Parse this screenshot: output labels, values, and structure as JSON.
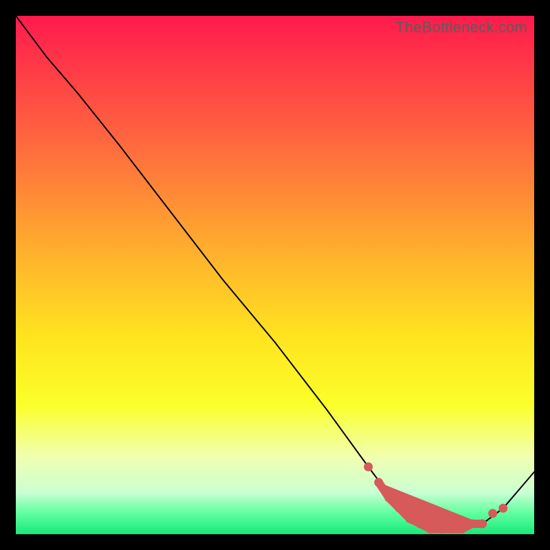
{
  "watermark": "TheBottleneck.com",
  "chart_data": {
    "type": "line",
    "title": "",
    "xlabel": "",
    "ylabel": "",
    "ylim": [
      0,
      100
    ],
    "xlim": [
      0,
      100
    ],
    "background_gradient_stops": [
      {
        "pct": 0,
        "color": "#ff1a4d"
      },
      {
        "pct": 10,
        "color": "#ff3a47"
      },
      {
        "pct": 25,
        "color": "#ff6a3e"
      },
      {
        "pct": 45,
        "color": "#ffae2e"
      },
      {
        "pct": 62,
        "color": "#ffe41f"
      },
      {
        "pct": 75,
        "color": "#fbff2a"
      },
      {
        "pct": 85,
        "color": "#f1ffb0"
      },
      {
        "pct": 92,
        "color": "#c9ffd2"
      },
      {
        "pct": 96,
        "color": "#5effa0"
      },
      {
        "pct": 100,
        "color": "#19e87a"
      }
    ],
    "series": [
      {
        "name": "bottleneck-curve",
        "x": [
          0,
          6,
          12,
          20,
          30,
          40,
          50,
          60,
          68,
          74,
          78,
          82,
          86,
          90,
          94,
          100
        ],
        "y": [
          100,
          92,
          85,
          75,
          62,
          49,
          37,
          24,
          13,
          5,
          2,
          1,
          1,
          2,
          5,
          12
        ]
      }
    ],
    "highlight_points": {
      "name": "optimal-zone-dots",
      "color": "#d65a5a",
      "x": [
        68,
        70,
        72,
        74,
        76,
        78,
        80,
        82,
        84,
        86,
        88,
        90,
        92,
        94
      ],
      "y": [
        13,
        10,
        7,
        5,
        3,
        2,
        1,
        1,
        1,
        1,
        2,
        2,
        4,
        5
      ]
    }
  }
}
